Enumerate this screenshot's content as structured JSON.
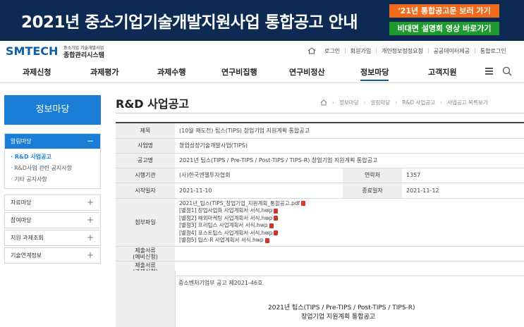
{
  "banner": {
    "title": "2021년 중소기업기술개발지원사업 통합공고 안내",
    "btn_notice": "'21년 통합공고문 보러 가기",
    "btn_video": "비대면 설명회 영상 바로가기"
  },
  "logo": {
    "main": "SMTECH",
    "sub1": "중소기업 기술개발사업",
    "sub2": "종합관리시스템"
  },
  "util_links": [
    "로그인",
    "회원가입",
    "개인정보정정요청",
    "공공데이터제공",
    "통합로그인"
  ],
  "gnb": [
    "과제신청",
    "과제평가",
    "과제수행",
    "연구비집행",
    "연구비정산",
    "정보마당",
    "고객지원"
  ],
  "sidebar": {
    "heading": "정보마당",
    "open_group": "알림마당",
    "sub_items": [
      "R&D 사업공고",
      "R&D사업 관련 공지사항",
      "기타 공지사항"
    ],
    "groups": [
      "자료마당",
      "참여마당",
      "지원 과제조회",
      "기술연계정보"
    ]
  },
  "page": {
    "title": "R&D 사업공고",
    "breadcrumb": [
      "정보마당",
      "알림마당",
      "R&D 사업공고",
      "사업공고 목록보기"
    ]
  },
  "detail": {
    "labels": {
      "title": "제목",
      "program": "사업명",
      "notice": "공고명",
      "agency": "시행기관",
      "contact": "연락처",
      "start": "시작일자",
      "end": "종료일자",
      "files": "첨부파일",
      "submit1": "제출서류\n(예비신청)",
      "submit2": "제출서류\n(과제신청)"
    },
    "values": {
      "title": "(10월 재도전) 팁스(TIPS) 창업기업 지원계획 통합공고",
      "program": "창업성장기술개발사업(TIPS)",
      "notice": "2021년 팁스(TIPS / Pre-TIPS / Post-TIPS / TIPS-R) 창업기업 지원계획 통합공고",
      "agency": "(사)한국엔젤투자협회",
      "contact": "1357",
      "start": "2021-11-10",
      "end": "2021-11-12"
    },
    "files": [
      "2021년_팁스(TIPS_창업기업_지원계획_통합공고.pdf",
      "[별첨1] 창업사업화 사업계획서 서식.hwp",
      "[별첨2] 해외마케팅 사업계획서 서식.hwp",
      "[별첨3] 프리팁스 사업계획서 서식.hwp",
      "[별첨4] 포스트팁스 사업계획서 서식.hwp",
      "[별첨5] 팁스-R 사업계획서 서식.hwp"
    ],
    "body_line1": "중소벤처기업부 공고 제2021-46호",
    "body_line2": "2021년 팁스(TIPS / Pre-TIPS / Post-TIPS / TIPS-R)",
    "body_line3": "창업기업 지원계획 통합공고"
  }
}
